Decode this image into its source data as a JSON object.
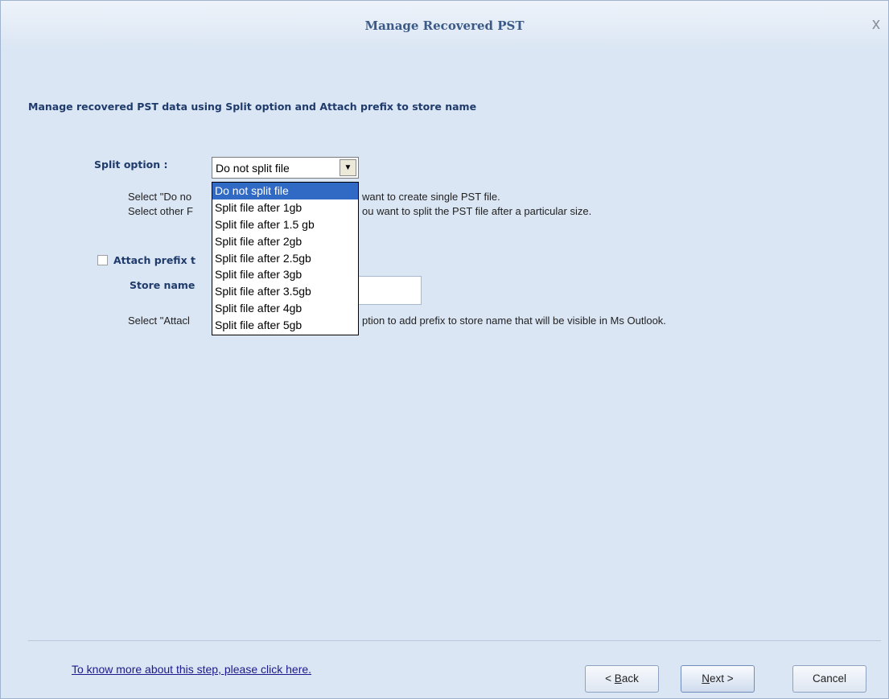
{
  "window": {
    "title": "Manage Recovered PST",
    "close_glyph": "x"
  },
  "heading": "Manage recovered PST data using Split option and Attach prefix to store name",
  "split": {
    "label": "Split option :",
    "selected": "Do not split file",
    "arrow_glyph": "▼",
    "help_line1": "Select \"Do no",
    "help_line1_tail": "want to create single PST file.",
    "help_line2": "Select other F",
    "help_line2_tail": "ou want to split the PST file after a particular size.",
    "options": [
      "Do not split file",
      "Split file after 1gb",
      "Split file after 1.5 gb",
      "Split file after 2gb",
      "Split file after 2.5gb",
      "Split file after 3gb",
      "Split file after 3.5gb",
      "Split file after 4gb",
      "Split file after 5gb"
    ]
  },
  "prefix": {
    "checkbox_label": "Attach prefix t",
    "checked": false,
    "store_label": "Store name",
    "store_value": "",
    "help_head": "Select \"Attacl",
    "help_tail": "ption to add prefix to store name that will be visible in Ms Outlook."
  },
  "footer": {
    "help_link": "To know more about this step, please click here.",
    "back": {
      "prefix": "< ",
      "accel": "B",
      "rest": "ack"
    },
    "next": {
      "accel": "N",
      "rest": "ext >"
    },
    "cancel": "Cancel"
  }
}
